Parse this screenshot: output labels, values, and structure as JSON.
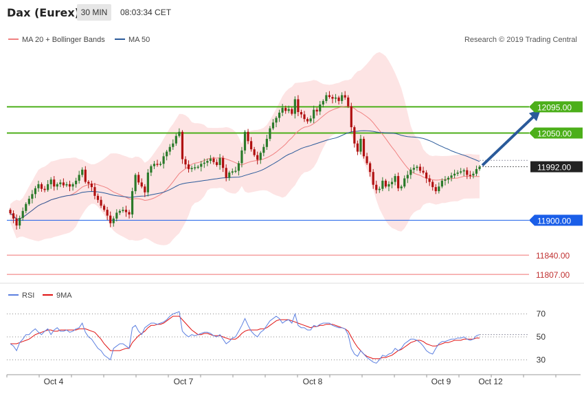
{
  "header": {
    "title": "Dax (Eurex)",
    "timeframe": "30 MIN",
    "time": "08:03:34 CET"
  },
  "legend": {
    "ma20_bb": "MA 20 + Bollinger Bands",
    "ma50": "MA 50",
    "copyright": "Research © 2019 Trading Central"
  },
  "rsi_legend": {
    "rsi": "RSI",
    "ma9": "9MA"
  },
  "colors": {
    "up": "#2a7a2a",
    "down": "#b01010",
    "bb_fill": "#fde4e4",
    "ma20": "#f08080",
    "ma50": "#2a5a9a",
    "resistance": "#4caf1a",
    "support_blue": "#1a5ee8",
    "support_red": "#f07070",
    "arrow": "#2a5a9a",
    "rsi": "#5b7fe0",
    "rsi_ma": "#e01010"
  },
  "chart_data": {
    "type": "candlestick",
    "ylim": [
      11800,
      12190
    ],
    "levels": [
      {
        "value": 12095,
        "label": "12095.00",
        "kind": "resistance"
      },
      {
        "value": 12050,
        "label": "12050.00",
        "kind": "resistance"
      },
      {
        "value": 11992,
        "label": "11992.00",
        "kind": "current"
      },
      {
        "value": 11900,
        "label": "11900.00",
        "kind": "support-strong"
      },
      {
        "value": 11840,
        "label": "11840.00",
        "kind": "support"
      },
      {
        "value": 11807,
        "label": "11807.00",
        "kind": "support"
      }
    ],
    "x_tick_labels": [
      "Oct 4",
      "Oct 7",
      "Oct 8",
      "Oct 9",
      "Oct 12"
    ],
    "forecast_target": 12095,
    "closes": [
      11912,
      11903,
      11891,
      11904,
      11916,
      11928,
      11937,
      11945,
      11955,
      11962,
      11954,
      11952,
      11962,
      11970,
      11958,
      11962,
      11965,
      11960,
      11962,
      11958,
      11962,
      11968,
      11978,
      11987,
      11966,
      11963,
      11957,
      11942,
      11935,
      11925,
      11918,
      11908,
      11895,
      11903,
      11913,
      11916,
      11918,
      11914,
      11910,
      11950,
      11978,
      11965,
      11958,
      11948,
      11982,
      11993,
      11997,
      11996,
      11997,
      12010,
      12018,
      12026,
      12032,
      12045,
      12052,
      12005,
      11996,
      11988,
      11990,
      11991,
      11992,
      11997,
      11999,
      12002,
      12006,
      12000,
      11995,
      12007,
      11990,
      11973,
      11982,
      11984,
      11985,
      11998,
      12020,
      12052,
      12036,
      12022,
      12012,
      12004,
      12016,
      12026,
      12040,
      12058,
      12068,
      12076,
      12085,
      12093,
      12088,
      12091,
      12083,
      12108,
      12086,
      12082,
      12074,
      12070,
      12075,
      12090,
      12087,
      12099,
      12105,
      12115,
      12112,
      12109,
      12111,
      12105,
      12115,
      12111,
      12096,
      12060,
      12032,
      12018,
      12040,
      12010,
      11998,
      11983,
      11961,
      11952,
      11954,
      11968,
      11958,
      11962,
      11966,
      11976,
      11955,
      11958,
      11972,
      11978,
      11987,
      11990,
      11992,
      11985,
      11982,
      11972,
      11966,
      11957,
      11950,
      11958,
      11968,
      11970,
      11973,
      11977,
      11980,
      11982,
      11984,
      11986,
      11978,
      11977,
      11980,
      11988,
      11992
    ],
    "rsi": {
      "ylim": [
        20,
        80
      ],
      "ticks": [
        30,
        50,
        70
      ],
      "values": [
        44,
        42,
        38,
        45,
        48,
        52,
        52,
        55,
        57,
        54,
        52,
        55,
        57,
        52,
        56,
        58,
        55,
        55,
        56,
        54,
        55,
        57,
        58,
        62,
        54,
        50,
        48,
        44,
        40,
        38,
        34,
        32,
        30,
        40,
        42,
        44,
        44,
        42,
        40,
        58,
        60,
        55,
        52,
        58,
        60,
        62,
        62,
        61,
        62,
        63,
        65,
        68,
        70,
        71,
        72,
        55,
        52,
        50,
        52,
        51,
        52,
        53,
        54,
        54,
        53,
        51,
        50,
        52,
        48,
        44,
        46,
        49,
        50,
        55,
        60,
        66,
        60,
        55,
        52,
        50,
        54,
        56,
        60,
        64,
        66,
        68,
        66,
        62,
        64,
        65,
        62,
        70,
        60,
        58,
        58,
        56,
        56,
        60,
        59,
        61,
        62,
        62,
        62,
        60,
        59,
        58,
        58,
        57,
        52,
        40,
        35,
        33,
        38,
        35,
        32,
        30,
        28,
        27,
        30,
        34,
        33,
        35,
        36,
        40,
        38,
        40,
        44,
        46,
        48,
        48,
        47,
        45,
        42,
        38,
        36,
        35,
        40,
        44,
        46,
        46,
        47,
        48,
        48,
        49,
        49,
        50,
        48,
        47,
        48,
        51,
        52
      ],
      "ma9": [
        44,
        44,
        44,
        45,
        46,
        47,
        48,
        50,
        52,
        53,
        54,
        55,
        56,
        56,
        55,
        55,
        56,
        56,
        56,
        56,
        56,
        56,
        57,
        57,
        57,
        56,
        55,
        54,
        51,
        48,
        44,
        41,
        38,
        38,
        38,
        38,
        39,
        40,
        40,
        45,
        48,
        51,
        53,
        55,
        58,
        60,
        60,
        61,
        61,
        62,
        64,
        66,
        68,
        68,
        68,
        65,
        62,
        59,
        56,
        54,
        52,
        52,
        53,
        53,
        52,
        51,
        51,
        51,
        50,
        49,
        48,
        48,
        48,
        50,
        53,
        55,
        56,
        56,
        56,
        56,
        57,
        57,
        58,
        60,
        62,
        64,
        65,
        65,
        65,
        65,
        64,
        63,
        62,
        61,
        60,
        59,
        58,
        59,
        59,
        60,
        60,
        61,
        61,
        61,
        60,
        59,
        58,
        57,
        55,
        50,
        45,
        41,
        38,
        35,
        33,
        32,
        31,
        31,
        31,
        32,
        32,
        33,
        34,
        36,
        38,
        39,
        41,
        43,
        45,
        46,
        47,
        47,
        46,
        44,
        43,
        42,
        42,
        43,
        44,
        45,
        45,
        46,
        47,
        47,
        47,
        48,
        48,
        48,
        48,
        49,
        49
      ]
    }
  }
}
